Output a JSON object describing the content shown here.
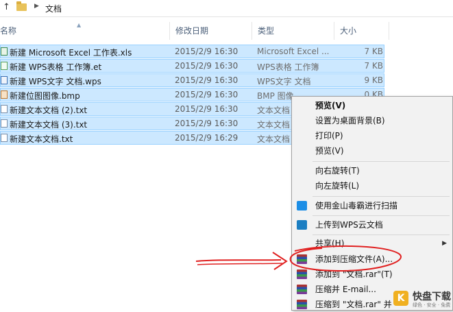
{
  "address": {
    "up_icon": "up-arrow-icon",
    "folder_icon": "folder-icon",
    "crumb": "文档"
  },
  "columns": {
    "name": "名称",
    "modified": "修改日期",
    "type": "类型",
    "size": "大小"
  },
  "files": [
    {
      "name": "新建 Microsoft Excel 工作表.xls",
      "modified": "2015/2/9 16:30",
      "type": "Microsoft Excel ...",
      "size": "7 KB",
      "icon": "xls"
    },
    {
      "name": "新建 WPS表格 工作簿.et",
      "modified": "2015/2/9 16:30",
      "type": "WPS表格 工作簿",
      "size": "7 KB",
      "icon": "et"
    },
    {
      "name": "新建 WPS文字 文档.wps",
      "modified": "2015/2/9 16:30",
      "type": "WPS文字 文档",
      "size": "9 KB",
      "icon": "wps"
    },
    {
      "name": "新建位图图像.bmp",
      "modified": "2015/2/9 16:30",
      "type": "BMP 图像",
      "size": "0 KB",
      "icon": "bmp"
    },
    {
      "name": "新建文本文档 (2).txt",
      "modified": "2015/2/9 16:30",
      "type": "文本文档",
      "size": "",
      "icon": "txt"
    },
    {
      "name": "新建文本文档 (3).txt",
      "modified": "2015/2/9 16:30",
      "type": "文本文档",
      "size": "",
      "icon": "txt"
    },
    {
      "name": "新建文本文档.txt",
      "modified": "2015/2/9 16:29",
      "type": "文本文档",
      "size": "",
      "icon": "txt"
    }
  ],
  "context_menu": {
    "items": [
      {
        "label": "预览(V)",
        "bold": true
      },
      {
        "label": "设置为桌面背景(B)"
      },
      {
        "label": "打印(P)"
      },
      {
        "label": "预览(V)"
      },
      {
        "label": "向右旋转(T)"
      },
      {
        "label": "向左旋转(L)"
      },
      {
        "label": "使用金山毒霸进行扫描",
        "icon": "jinshan-icon"
      },
      {
        "label": "上传到WPS云文档",
        "icon": "wps-cloud-icon"
      },
      {
        "label": "共享(H)",
        "submenu": true
      },
      {
        "label": "添加到压缩文件(A)...",
        "icon": "winrar-icon"
      },
      {
        "label": "添加到 \"文档.rar\"(T)",
        "icon": "winrar-icon"
      },
      {
        "label": "压缩并 E-mail...",
        "icon": "winrar-icon"
      },
      {
        "label": "压缩到 \"文档.rar\" 并",
        "icon": "winrar-icon"
      }
    ]
  },
  "annotation_color": "#e02020",
  "selection_color": "#cce8ff",
  "watermark": {
    "title": "快盘下载",
    "subtitle": "绿色 · 安全 · 免费"
  }
}
